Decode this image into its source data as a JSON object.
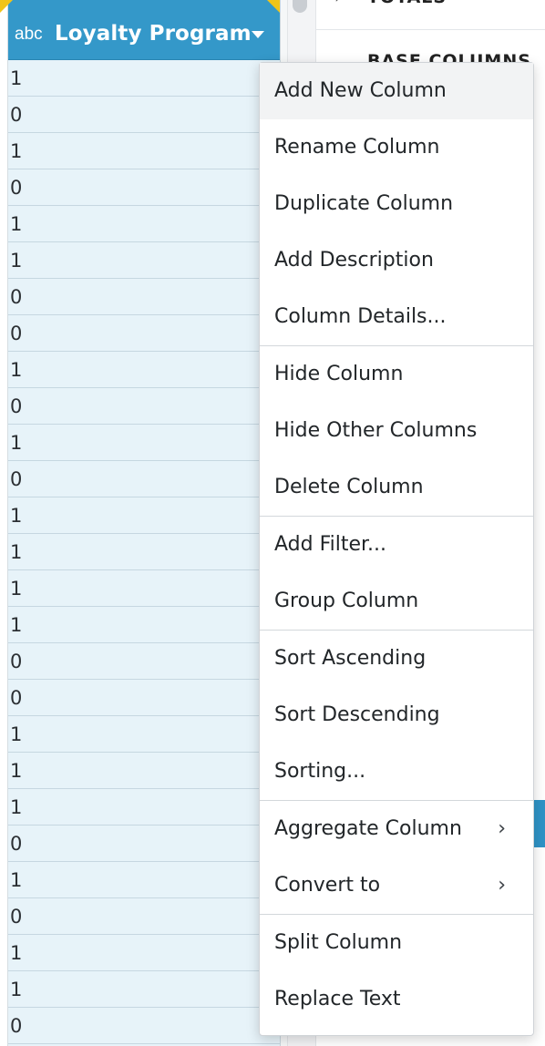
{
  "column": {
    "type_tag": "abc",
    "title": "Loyalty Program",
    "values": [
      "1",
      "0",
      "1",
      "0",
      "1",
      "1",
      "0",
      "0",
      "1",
      "0",
      "1",
      "0",
      "1",
      "1",
      "1",
      "1",
      "0",
      "0",
      "1",
      "1",
      "1",
      "0",
      "1",
      "0",
      "1",
      "1",
      "0"
    ]
  },
  "side_panel": {
    "heading_1": "TOTALS",
    "heading_2": "BASE COLUMNS",
    "chevron": "›"
  },
  "menu": {
    "groups": [
      [
        {
          "label": "Add New Column",
          "name": "menu-add-new-column"
        },
        {
          "label": "Rename Column",
          "name": "menu-rename-column"
        },
        {
          "label": "Duplicate Column",
          "name": "menu-duplicate-column"
        },
        {
          "label": "Add Description",
          "name": "menu-add-description"
        },
        {
          "label": "Column Details...",
          "name": "menu-column-details"
        }
      ],
      [
        {
          "label": "Hide Column",
          "name": "menu-hide-column"
        },
        {
          "label": "Hide Other Columns",
          "name": "menu-hide-other-columns"
        },
        {
          "label": "Delete Column",
          "name": "menu-delete-column"
        }
      ],
      [
        {
          "label": "Add Filter...",
          "name": "menu-add-filter"
        },
        {
          "label": "Group Column",
          "name": "menu-group-column"
        }
      ],
      [
        {
          "label": "Sort Ascending",
          "name": "menu-sort-ascending"
        },
        {
          "label": "Sort Descending",
          "name": "menu-sort-descending"
        },
        {
          "label": "Sorting...",
          "name": "menu-sorting"
        }
      ],
      [
        {
          "label": "Aggregate Column",
          "name": "menu-aggregate-column",
          "submenu": true
        },
        {
          "label": "Convert to",
          "name": "menu-convert-to",
          "submenu": true
        }
      ],
      [
        {
          "label": "Split Column",
          "name": "menu-split-column"
        },
        {
          "label": "Replace Text",
          "name": "menu-replace-text"
        }
      ]
    ],
    "submenu_glyph": "›",
    "hovered_index": "0.0"
  },
  "colors": {
    "header_bg": "#3498c9",
    "cell_bg": "#e7f3f9",
    "marker": "#f0c419"
  }
}
